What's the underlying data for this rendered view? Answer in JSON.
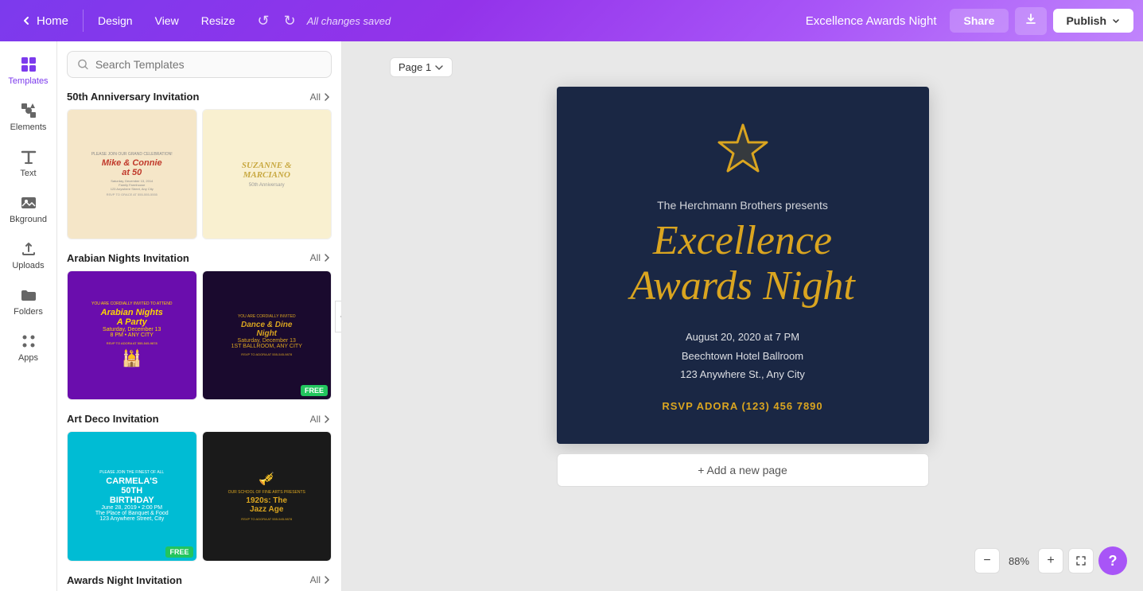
{
  "navbar": {
    "home_label": "Home",
    "design_label": "Design",
    "view_label": "View",
    "resize_label": "Resize",
    "saved_status": "All changes saved",
    "doc_title": "Excellence Awards Night",
    "share_label": "Share",
    "publish_label": "Publish"
  },
  "sidebar": {
    "items": [
      {
        "id": "templates",
        "label": "Templates"
      },
      {
        "id": "elements",
        "label": "Elements"
      },
      {
        "id": "text",
        "label": "Text"
      },
      {
        "id": "bkground",
        "label": "Bkground"
      },
      {
        "id": "uploads",
        "label": "Uploads"
      },
      {
        "id": "folders",
        "label": "Folders"
      },
      {
        "id": "apps",
        "label": "Apps"
      }
    ]
  },
  "templates_panel": {
    "search_placeholder": "Search Templates",
    "sections": [
      {
        "id": "50th-anniversary",
        "title": "50th Anniversary Invitation",
        "all_label": "All"
      },
      {
        "id": "arabian-nights",
        "title": "Arabian Nights Invitation",
        "all_label": "All"
      },
      {
        "id": "art-deco",
        "title": "Art Deco Invitation",
        "all_label": "All"
      },
      {
        "id": "awards-night",
        "title": "Awards Night Invitation",
        "all_label": "All"
      }
    ]
  },
  "canvas": {
    "page_label": "Page 1",
    "card": {
      "presenter": "The Herchmann Brothers presents",
      "title_line1": "Excellence",
      "title_line2": "Awards Night",
      "date": "August 20, 2020 at 7 PM",
      "venue": "Beechtown Hotel Ballroom",
      "address": "123 Anywhere St., Any City",
      "rsvp": "RSVP ADORA (123) 456 7890"
    },
    "add_page_label": "+ Add a new page"
  },
  "zoom": {
    "minus_label": "−",
    "level": "88%",
    "plus_label": "+",
    "help_label": "?"
  },
  "colors": {
    "purple_brand": "#7c3aed",
    "gold": "#daa520",
    "card_bg": "#1a2744"
  }
}
